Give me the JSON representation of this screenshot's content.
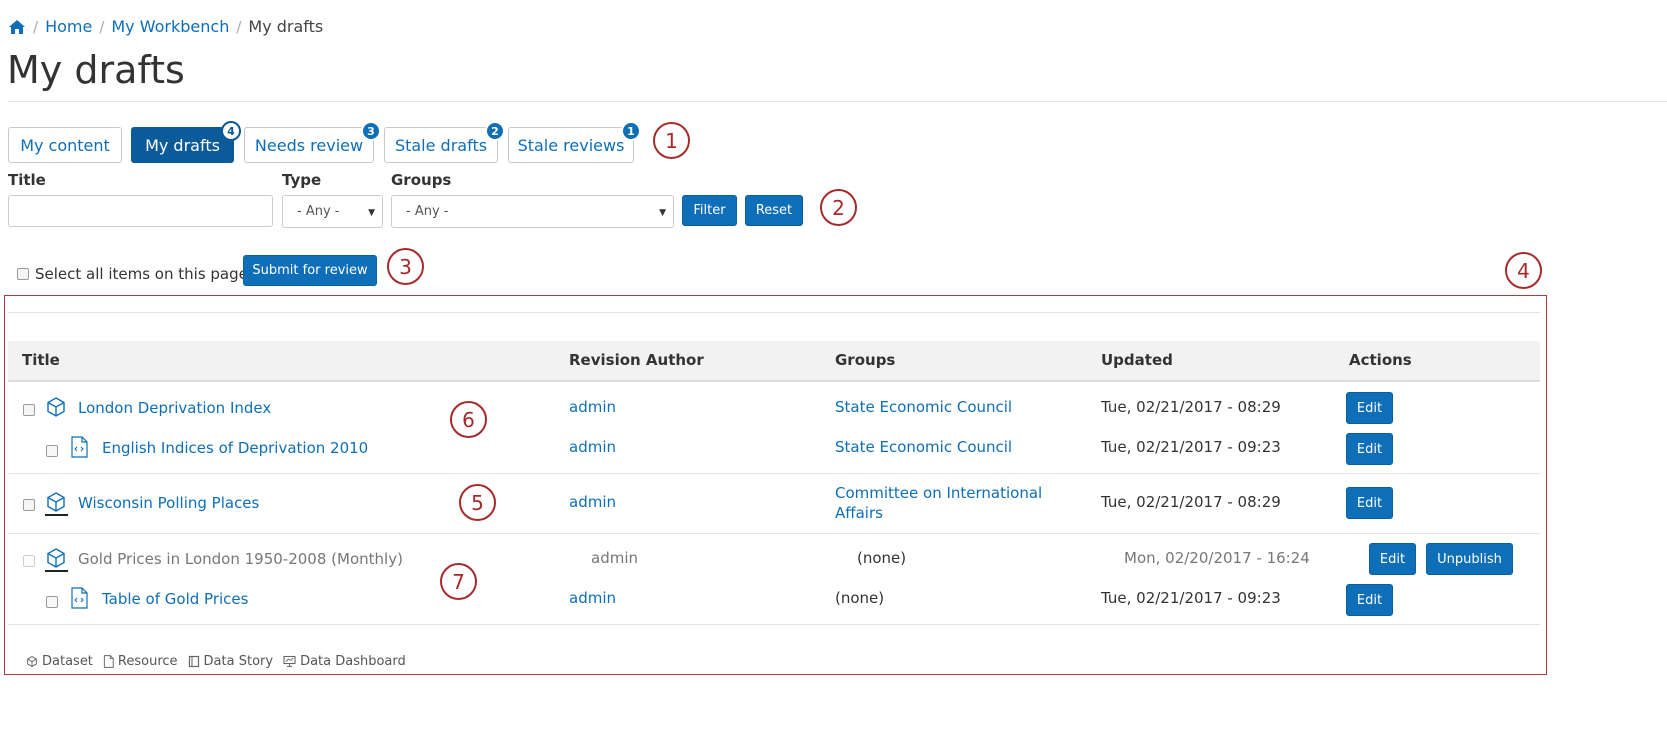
{
  "breadcrumb": {
    "home": "Home",
    "workbench": "My Workbench",
    "current": "My drafts"
  },
  "page_title": "My drafts",
  "tabs": [
    {
      "label": "My content",
      "badge": ""
    },
    {
      "label": "My drafts",
      "badge": "4"
    },
    {
      "label": "Needs review",
      "badge": "3"
    },
    {
      "label": "Stale drafts",
      "badge": "2"
    },
    {
      "label": "Stale reviews",
      "badge": "1"
    }
  ],
  "callouts": [
    "1",
    "2",
    "3",
    "4",
    "5",
    "6",
    "7"
  ],
  "filters": {
    "title_label": "Title",
    "title_value": "",
    "type_label": "Type",
    "type_value": "- Any -",
    "groups_label": "Groups",
    "groups_value": "- Any -",
    "filter_button": "Filter",
    "reset_button": "Reset"
  },
  "bulk": {
    "select_all_label": "Select all items on this page",
    "submit_button": "Submit for review"
  },
  "table": {
    "headers": [
      "Title",
      "Revision Author",
      "Groups",
      "Updated",
      "Actions"
    ],
    "rows": [
      {
        "title": "London Deprivation Index",
        "author": "admin",
        "groups": "State Economic Council",
        "updated": "Tue, 02/21/2017 - 08:29",
        "actions": [
          "Edit"
        ]
      },
      {
        "title": "English Indices of Deprivation 2010",
        "author": "admin",
        "groups": "State Economic Council",
        "updated": "Tue, 02/21/2017 - 09:23",
        "actions": [
          "Edit"
        ]
      },
      {
        "title": "Wisconsin Polling Places",
        "author": "admin",
        "groups": "Committee on International Affairs",
        "updated": "Tue, 02/21/2017 - 08:29",
        "actions": [
          "Edit"
        ]
      },
      {
        "title": "Gold Prices in London 1950-2008 (Monthly)",
        "author": "admin",
        "groups": "(none)",
        "updated": "Mon, 02/20/2017 - 16:24",
        "actions": [
          "Edit",
          "Unpublish"
        ]
      },
      {
        "title": "Table of Gold Prices",
        "author": "admin",
        "groups": "(none)",
        "updated": "Tue, 02/21/2017 - 09:23",
        "actions": [
          "Edit"
        ]
      }
    ]
  },
  "legend": [
    "Dataset",
    "Resource",
    "Data Story",
    "Data Dashboard"
  ],
  "colors": {
    "link": "#0e6eb8",
    "active_tab": "#0b5a99",
    "annotation": "#a72a2a"
  }
}
